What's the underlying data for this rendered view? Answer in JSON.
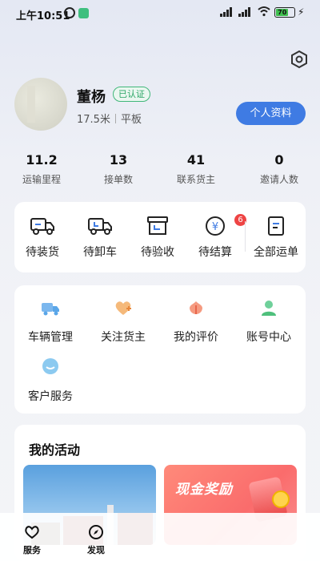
{
  "status_bar": {
    "time": "上午10:51",
    "battery": "70"
  },
  "profile": {
    "name": "董杨",
    "verified_label": "已认证",
    "vehicle_length": "17.5米",
    "vehicle_type": "平板",
    "profile_button": "个人资料"
  },
  "stats": [
    {
      "value": "11.2",
      "label": "运输里程"
    },
    {
      "value": "13",
      "label": "接单数"
    },
    {
      "value": "41",
      "label": "联系货主"
    },
    {
      "value": "0",
      "label": "邀请人数"
    }
  ],
  "orders": [
    {
      "label": "待装货",
      "icon": "truck-load-icon"
    },
    {
      "label": "待卸车",
      "icon": "truck-unload-icon"
    },
    {
      "label": "待验收",
      "icon": "inspection-box-icon"
    },
    {
      "label": "待结算",
      "icon": "settlement-yuan-icon",
      "badge": "6"
    },
    {
      "label": "全部运单",
      "icon": "waybill-list-icon"
    }
  ],
  "services": [
    {
      "label": "车辆管理",
      "icon": "vehicle-icon",
      "color": "#5aa6e8"
    },
    {
      "label": "关注货主",
      "icon": "heart-plus-icon",
      "color": "#f0a35a"
    },
    {
      "label": "我的评价",
      "icon": "flower-icon",
      "color": "#f07a5a"
    },
    {
      "label": "账号中心",
      "icon": "user-icon",
      "color": "#4fc07c"
    },
    {
      "label": "客户服务",
      "icon": "chat-bubble-icon",
      "color": "#5ab0e8"
    }
  ],
  "activities": {
    "title": "我的活动",
    "banner_right_text": "现金奖励"
  },
  "bottom_nav": [
    {
      "label": "服务",
      "icon": "heart-outline-icon"
    },
    {
      "label": "发现",
      "icon": "compass-icon"
    }
  ]
}
